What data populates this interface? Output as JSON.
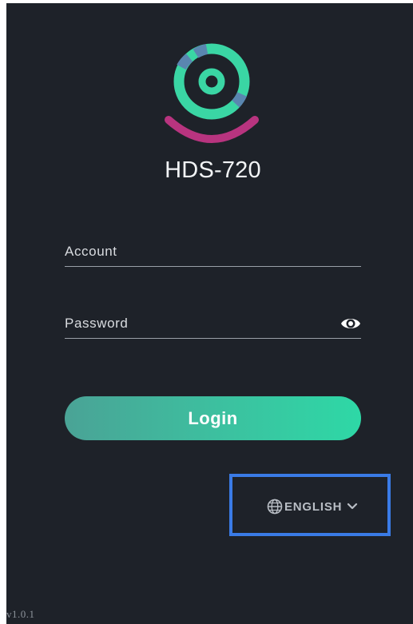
{
  "app": {
    "title": "HDS-720",
    "logo_icon": "camera-lens-logo-icon",
    "colors": {
      "background": "#1e2229",
      "accent_green": "#3ad6a4",
      "accent_magenta": "#b8347f",
      "accent_blue": "#5a86b0",
      "highlight_border": "#3a7be6"
    }
  },
  "form": {
    "account_label": "Account",
    "password_label": "Password",
    "password_toggle_icon": "eye-icon",
    "login_label": "Login"
  },
  "language": {
    "icon": "globe-icon",
    "selected": "ENGLISH",
    "dropdown_icon": "chevron-down-icon"
  },
  "footer": {
    "version": "v1.0.1"
  }
}
